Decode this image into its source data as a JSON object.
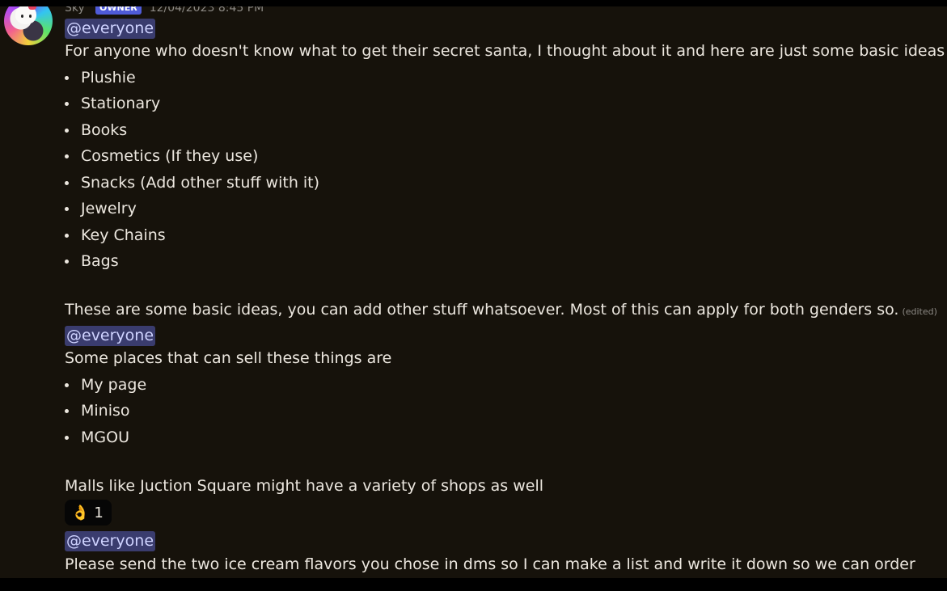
{
  "message": {
    "username": "Sky",
    "role_badge": "OWNER",
    "timestamp": "12/04/2023 8:45 PM",
    "avatar_icon": "hello-kitty-avatar-icon"
  },
  "posts": [
    {
      "mention": "@everyone",
      "intro": "For anyone who doesn't know what to get their secret santa, I thought about it and here are just some basic ideas",
      "items": [
        "Plushie",
        "Stationary",
        "Books",
        "Cosmetics (If they use)",
        "Snacks (Add other stuff with it)",
        "Jewelry",
        "Key Chains",
        "Bags"
      ],
      "closing": "These are some basic ideas, you can add other stuff whatsoever. Most of this can apply for both genders so.",
      "edited_label": "(edited)"
    },
    {
      "mention": "@everyone",
      "intro": "Some places that can sell these things are",
      "items": [
        "My page",
        "Miniso",
        "MGOU"
      ],
      "closing": "Malls like Juction Square might have a variety of shops as well",
      "reaction": {
        "emoji": "👌",
        "count": "1"
      }
    },
    {
      "mention": "@everyone",
      "intro": "Please send the two ice cream flavors you chose in dms so I can make a list and write it down so we can order"
    }
  ],
  "colors": {
    "background": "#16120b",
    "text": "#ece7df",
    "mention_bg": "#3a3c6e",
    "mention_text": "#cfd3ff",
    "badge": "#4f5bd8"
  }
}
